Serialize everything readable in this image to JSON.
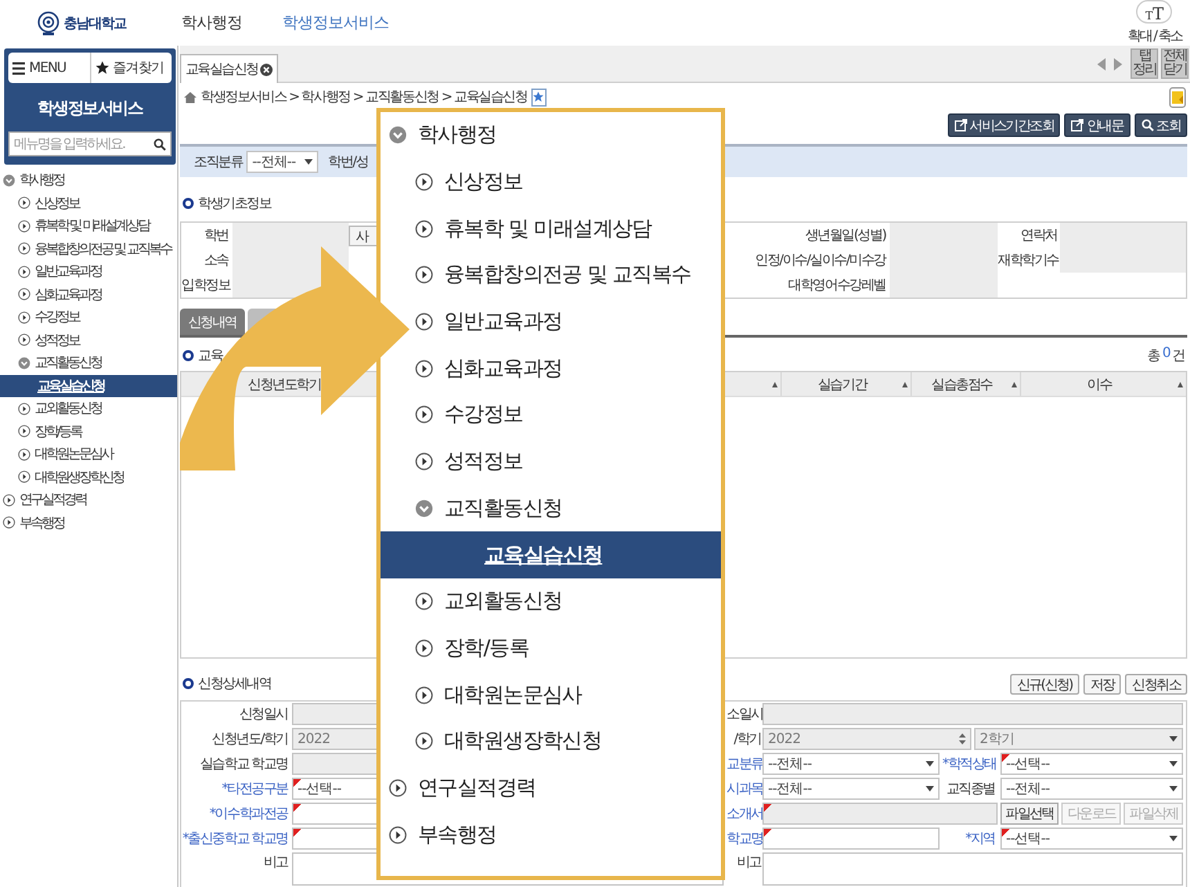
{
  "header": {
    "logo": "충남대학교",
    "nav": [
      {
        "label": "학사행정",
        "selected": false
      },
      {
        "label": "학생정보서비스",
        "selected": true
      }
    ],
    "size_glyphs": [
      "T",
      "T"
    ],
    "size_label": "확대 / 축소"
  },
  "sidebar": {
    "menu_button": "MENU",
    "favorites_button": "즐겨찾기",
    "title": "학생정보서비스",
    "search": {
      "placeholder": "메뉴명을 입력하세요."
    },
    "tree": [
      {
        "label": "학사행정",
        "kind": "folder",
        "expanded": true,
        "selected": false,
        "children": [
          {
            "label": "신상정보",
            "kind": "folder",
            "expanded": false,
            "selected": false
          },
          {
            "label": "휴복학 및 미래설계상담",
            "kind": "folder",
            "expanded": false,
            "selected": false
          },
          {
            "label": "융복합창의전공 및 교직복수",
            "kind": "folder",
            "expanded": false,
            "selected": false
          },
          {
            "label": "일반교육과정",
            "kind": "folder",
            "expanded": false,
            "selected": false
          },
          {
            "label": "심화교육과정",
            "kind": "folder",
            "expanded": false,
            "selected": false
          },
          {
            "label": "수강정보",
            "kind": "folder",
            "expanded": false,
            "selected": false
          },
          {
            "label": "성적정보",
            "kind": "folder",
            "expanded": false,
            "selected": false
          },
          {
            "label": "교직활동신청",
            "kind": "folder",
            "expanded": true,
            "selected": false,
            "children": [
              {
                "label": "교육실습신청",
                "kind": "page",
                "selected": true
              }
            ]
          },
          {
            "label": "교외활동신청",
            "kind": "folder",
            "expanded": false,
            "selected": false
          },
          {
            "label": "장학/등록",
            "kind": "folder",
            "expanded": false,
            "selected": false
          },
          {
            "label": "대학원논문심사",
            "kind": "folder",
            "expanded": false,
            "selected": false
          },
          {
            "label": "대학원생장학신청",
            "kind": "folder",
            "expanded": false,
            "selected": false
          }
        ]
      },
      {
        "label": "연구실적경력",
        "kind": "folder",
        "expanded": false,
        "selected": false
      },
      {
        "label": "부속행정",
        "kind": "folder",
        "expanded": false,
        "selected": false
      }
    ]
  },
  "tabs": [
    {
      "label": "교육실습신청",
      "selected": true
    }
  ],
  "tab_tools": [
    "탭 정리",
    "전체 닫기"
  ],
  "breadcrumb": "학생정보서비스 > 학사행정 > 교직활동신청 > 교육실습신청",
  "favorite": true,
  "actions": [
    {
      "label": "서비스기간조회",
      "kind": "popup"
    },
    {
      "label": "안내문",
      "kind": "popup"
    },
    {
      "label": "조회",
      "kind": "search"
    }
  ],
  "filter": {
    "label": "조직분류",
    "value": "--전체--",
    "next_label": "학번/성"
  },
  "student_info": {
    "title": "학생기초정보",
    "labels": [
      "학번",
      "소속",
      "입학정보"
    ],
    "button": "사",
    "mid_labels": [
      "생년월일(성별)",
      "인정/이수/실이수/미수강",
      "대학영어수강레벨"
    ],
    "right_labels": [
      "연락처",
      "재학학기수"
    ]
  },
  "sub_tabs": [
    {
      "label": "신청내역",
      "selected": true
    },
    {
      "selected": false
    }
  ],
  "grid": {
    "title": "교육",
    "total": "총",
    "count": "0",
    "unit": "건",
    "first_column": "신청년도학기",
    "columns": [
      "실습기간",
      "실습총점수",
      "이수"
    ]
  },
  "detail": {
    "title": "신청상세내역",
    "buttons": [
      "신규(신청)",
      "저장",
      "신청취소"
    ],
    "left": [
      {
        "label": "신청일시",
        "required": false,
        "cells": [
          {
            "kind": "readonly",
            "required": false
          }
        ]
      },
      {
        "label": "신청년도/학기",
        "required": false,
        "cells": [
          {
            "kind": "readonly",
            "value": "2022",
            "required": false
          }
        ]
      },
      {
        "label": "실습학교 학교명",
        "required": false,
        "cells": [
          {
            "kind": "readonly",
            "required": false
          }
        ]
      },
      {
        "label": "*타전공구분",
        "required": true,
        "cells": [
          {
            "kind": "select",
            "value": "--선택--",
            "required": true
          }
        ]
      },
      {
        "label": "*이수학과전공",
        "required": true,
        "cells": [
          {
            "kind": "input",
            "required": true
          }
        ]
      },
      {
        "label": "*출신중학교 학교명",
        "required": true,
        "cells": [
          {
            "kind": "input",
            "required": true
          }
        ]
      },
      {
        "label": "비고",
        "required": false,
        "cells": [
          {
            "kind": "textarea",
            "required": false
          }
        ]
      }
    ],
    "right": [
      {
        "label": "소일시",
        "required": false,
        "cells": [
          {
            "kind": "readonly",
            "required": false
          }
        ]
      },
      {
        "label": "/학기",
        "required": false,
        "cells": [
          {
            "kind": "spin",
            "value": "2022",
            "required": false
          },
          {
            "kind": "readonly_select",
            "value": "2학기",
            "required": false
          }
        ]
      },
      {
        "label": "교분류",
        "required": true,
        "cells": [
          {
            "kind": "select",
            "value": "--전체--",
            "required": false
          },
          {
            "kind": "label",
            "label": "*학적상태",
            "required": true
          },
          {
            "kind": "select",
            "value": "--선택--",
            "required": true
          }
        ]
      },
      {
        "label": "시과목",
        "required": true,
        "cells": [
          {
            "kind": "select",
            "value": "--전체--",
            "required": false
          },
          {
            "kind": "label",
            "label": "교직종별",
            "required": false
          },
          {
            "kind": "select",
            "value": "--전체--",
            "required": false
          }
        ]
      },
      {
        "label": "소개서",
        "required": true,
        "cells": [
          {
            "kind": "readonly",
            "required": true
          },
          {
            "kind": "button",
            "label": "파일선택",
            "disabled": false
          },
          {
            "kind": "button",
            "label": "다운로드",
            "disabled": true
          },
          {
            "kind": "button",
            "label": "파일삭제",
            "disabled": true
          }
        ]
      },
      {
        "label": "학교명",
        "required": true,
        "cells": [
          {
            "kind": "input",
            "required": true
          },
          {
            "kind": "label",
            "label": "*지역",
            "required": true
          },
          {
            "kind": "select",
            "value": "--선택--",
            "required": true
          }
        ]
      },
      {
        "label": "비고",
        "required": false,
        "cells": [
          {
            "kind": "textarea",
            "required": false
          }
        ]
      }
    ]
  },
  "overlay": {
    "tree": [
      {
        "label": "학사행정",
        "kind": "folder",
        "expanded": true,
        "selected": false,
        "children": [
          {
            "label": "신상정보",
            "kind": "folder",
            "expanded": false,
            "selected": false
          },
          {
            "label": "휴복학 및 미래설계상담",
            "kind": "folder",
            "expanded": false,
            "selected": false
          },
          {
            "label": "융복합창의전공 및 교직복수",
            "kind": "folder",
            "expanded": false,
            "selected": false
          },
          {
            "label": "일반교육과정",
            "kind": "folder",
            "expanded": false,
            "selected": false
          },
          {
            "label": "심화교육과정",
            "kind": "folder",
            "expanded": false,
            "selected": false
          },
          {
            "label": "수강정보",
            "kind": "folder",
            "expanded": false,
            "selected": false
          },
          {
            "label": "성적정보",
            "kind": "folder",
            "expanded": false,
            "selected": false
          },
          {
            "label": "교직활동신청",
            "kind": "folder",
            "expanded": true,
            "selected": false,
            "children": [
              {
                "label": "교육실습신청",
                "kind": "page",
                "selected": true
              }
            ]
          },
          {
            "label": "교외활동신청",
            "kind": "folder",
            "expanded": false,
            "selected": false
          },
          {
            "label": "장학/등록",
            "kind": "folder",
            "expanded": false,
            "selected": false
          },
          {
            "label": "대학원논문심사",
            "kind": "folder",
            "expanded": false,
            "selected": false
          },
          {
            "label": "대학원생장학신청",
            "kind": "folder",
            "expanded": false,
            "selected": false
          }
        ]
      },
      {
        "label": "연구실적경력",
        "kind": "folder",
        "expanded": false,
        "selected": false
      },
      {
        "label": "부속행정",
        "kind": "folder",
        "expanded": false,
        "selected": false
      }
    ]
  }
}
